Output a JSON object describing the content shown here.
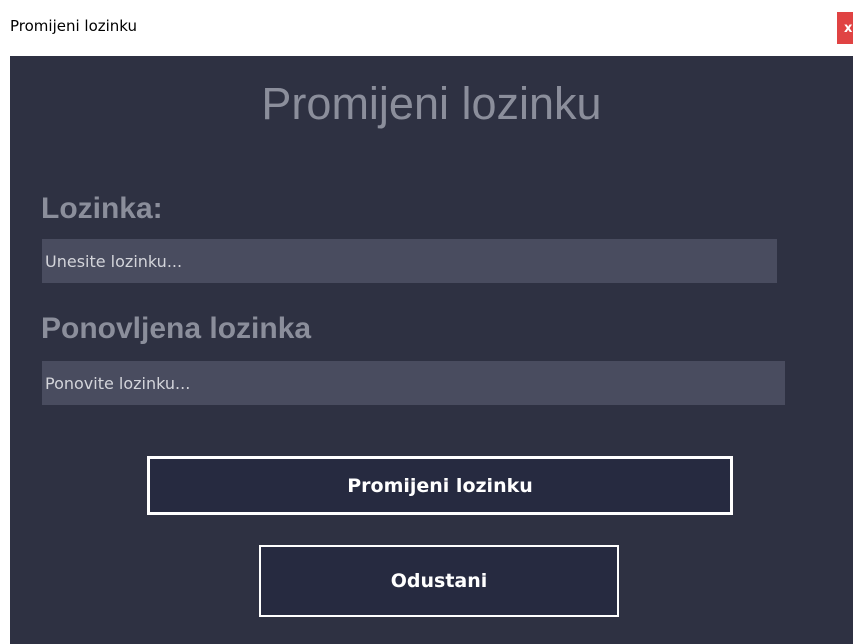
{
  "window": {
    "title": "Promijeni lozinku",
    "close_label": "x"
  },
  "form": {
    "heading": "Promijeni lozinku",
    "password_label": "Lozinka:",
    "password_placeholder": "Unesite lozinku...",
    "password_value": "",
    "repeat_label": "Ponovljena lozinka",
    "repeat_placeholder": "Ponovite lozinku...",
    "repeat_value": ""
  },
  "buttons": {
    "change_label": "Promijeni lozinku",
    "cancel_label": "Odustani"
  },
  "colors": {
    "panel_background": "#2e3142",
    "input_background": "#494c5f",
    "label_color": "#8b8e9b",
    "button_background": "#262a40",
    "close_background": "#e04343"
  }
}
